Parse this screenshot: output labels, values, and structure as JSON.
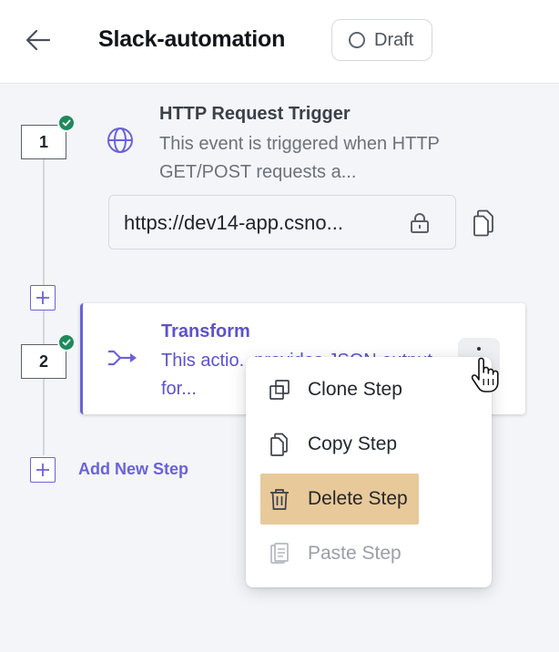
{
  "header": {
    "title": "Slack-automation",
    "status_label": "Draft"
  },
  "steps": [
    {
      "number": "1",
      "title": "HTTP Request Trigger",
      "description": "This event is triggered when HTTP GET/POST requests a...",
      "url": "https://dev14-app.csno...",
      "icon": "globe-icon",
      "completed": true
    },
    {
      "number": "2",
      "title": "Transform",
      "description": "This actio...provides JSON output for...",
      "icon": "transform-icon",
      "completed": true
    }
  ],
  "add_step_label": "Add New Step",
  "context_menu": {
    "items": [
      {
        "label": "Clone Step",
        "icon": "clone-icon",
        "highlighted": false,
        "disabled": false
      },
      {
        "label": "Copy Step",
        "icon": "copy-icon",
        "highlighted": false,
        "disabled": false
      },
      {
        "label": "Delete Step",
        "icon": "trash-icon",
        "highlighted": true,
        "disabled": false
      },
      {
        "label": "Paste Step",
        "icon": "paste-icon",
        "highlighted": false,
        "disabled": true
      }
    ]
  },
  "colors": {
    "accent": "#6a62d8",
    "success": "#1f8a5b",
    "highlight": "#e8c99a",
    "background": "#f4f5f9"
  }
}
